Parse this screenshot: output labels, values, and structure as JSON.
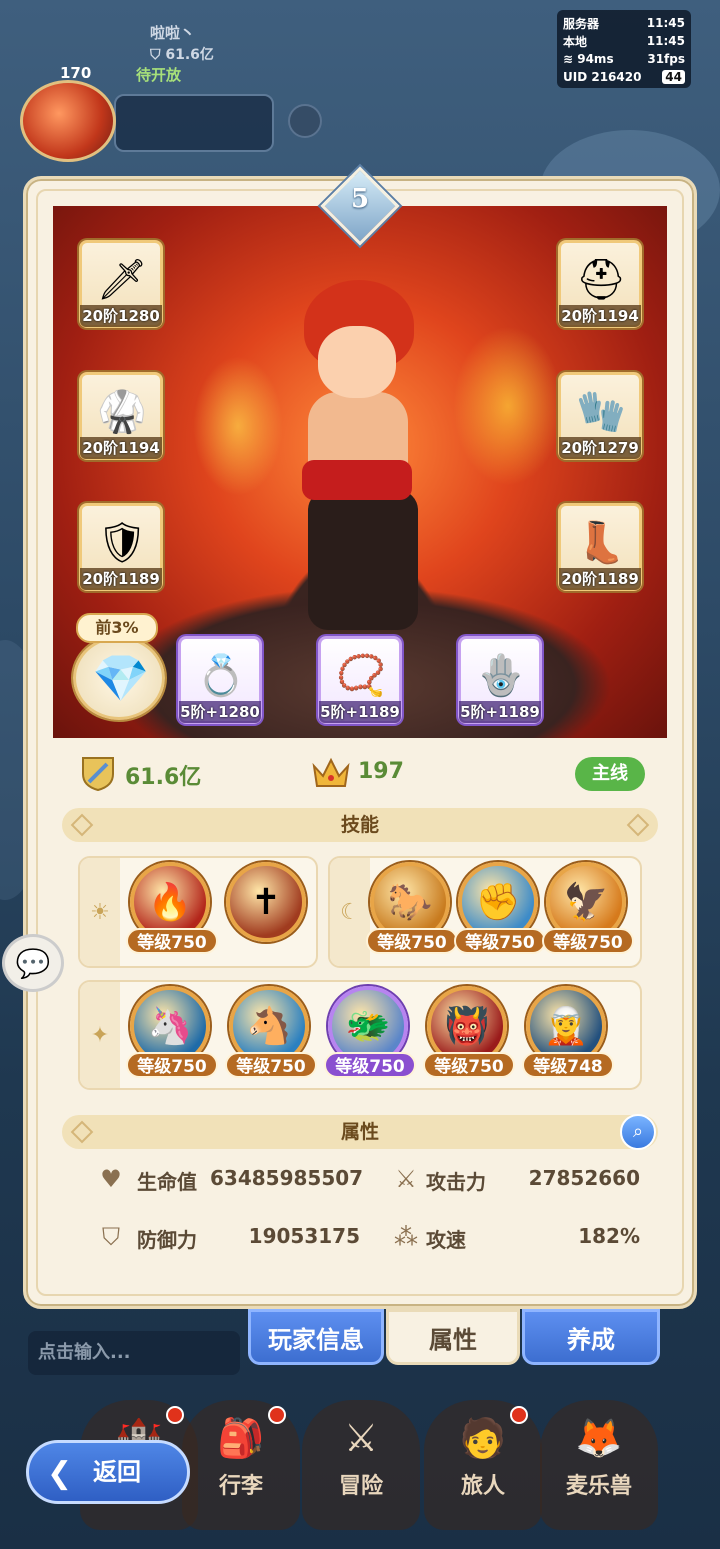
{
  "status": {
    "server_label": "服务器",
    "server_time": "11:45",
    "local_label": "本地",
    "local_time": "11:45",
    "ping": "94ms",
    "fps": "31fps",
    "uid": "UID 216420",
    "battery": "44"
  },
  "player": {
    "name": "啦啦丶",
    "power": "61.6亿",
    "level": "170",
    "pending": "待开放"
  },
  "hero": {
    "star_level": "5",
    "equipment_left": [
      {
        "icon": "sword-icon",
        "glyph": "🗡",
        "label": "20阶1280"
      },
      {
        "icon": "chest-armor-icon",
        "glyph": "🥋",
        "label": "20阶1194"
      },
      {
        "icon": "belt-armor-icon",
        "glyph": "🛡",
        "label": "20阶1189"
      }
    ],
    "equipment_right": [
      {
        "icon": "helmet-icon",
        "glyph": "⛑",
        "label": "20阶1194"
      },
      {
        "icon": "gauntlet-icon",
        "glyph": "🧤",
        "label": "20阶1279"
      },
      {
        "icon": "boots-icon",
        "glyph": "👢",
        "label": "20阶1189"
      }
    ],
    "accessories": [
      {
        "icon": "ring-icon",
        "glyph": "💍",
        "label": "5阶+1280"
      },
      {
        "icon": "necklace-icon",
        "glyph": "📿",
        "label": "5阶+1189"
      },
      {
        "icon": "earring-icon",
        "glyph": "🪬",
        "label": "5阶+1189"
      }
    ],
    "pet_tag": "前3%",
    "pet_glyph": "💎"
  },
  "stats": {
    "power": "61.6亿",
    "crown": "197",
    "mainline_button": "主线"
  },
  "skills_title": "技能",
  "skills_row1_left": [
    {
      "glyph": "🔥",
      "level": "等级750",
      "bg": "#b3261b"
    },
    {
      "glyph": "✝",
      "level": "",
      "bg": "#a03b1f"
    }
  ],
  "skills_row1_right": [
    {
      "glyph": "🐎",
      "level": "等级750",
      "bg": "#c87b1f"
    },
    {
      "glyph": "✊",
      "level": "等级750",
      "bg": "#3d8bc8"
    },
    {
      "glyph": "🦅",
      "level": "等级750",
      "bg": "#d67a1c"
    }
  ],
  "skills_row2": [
    {
      "glyph": "🦄",
      "level": "等级750",
      "bg": "#1f6ba8",
      "purple": false
    },
    {
      "glyph": "🐴",
      "level": "等级750",
      "bg": "#2b80c0",
      "purple": false
    },
    {
      "glyph": "🐲",
      "level": "等级750",
      "bg": "#5b86c9",
      "purple": true
    },
    {
      "glyph": "👹",
      "level": "等级750",
      "bg": "#9a1b1b",
      "purple": false
    },
    {
      "glyph": "🧝",
      "level": "等级748",
      "bg": "#22507e",
      "purple": false
    }
  ],
  "attributes_title": "属性",
  "attributes": {
    "hp_label": "生命值",
    "hp_value": "63485985507",
    "atk_label": "攻击力",
    "atk_value": "27852660",
    "def_label": "防御力",
    "def_value": "19053175",
    "spd_label": "攻速",
    "spd_value": "182%"
  },
  "tabs": {
    "player_info": "玩家信息",
    "attributes": "属性",
    "develop": "养成"
  },
  "chat_placeholder": "点击输入...",
  "nav": {
    "bag": "行李",
    "adventure": "冒险",
    "traveler": "旅人",
    "beast": "麦乐兽"
  },
  "back_label": "返回"
}
